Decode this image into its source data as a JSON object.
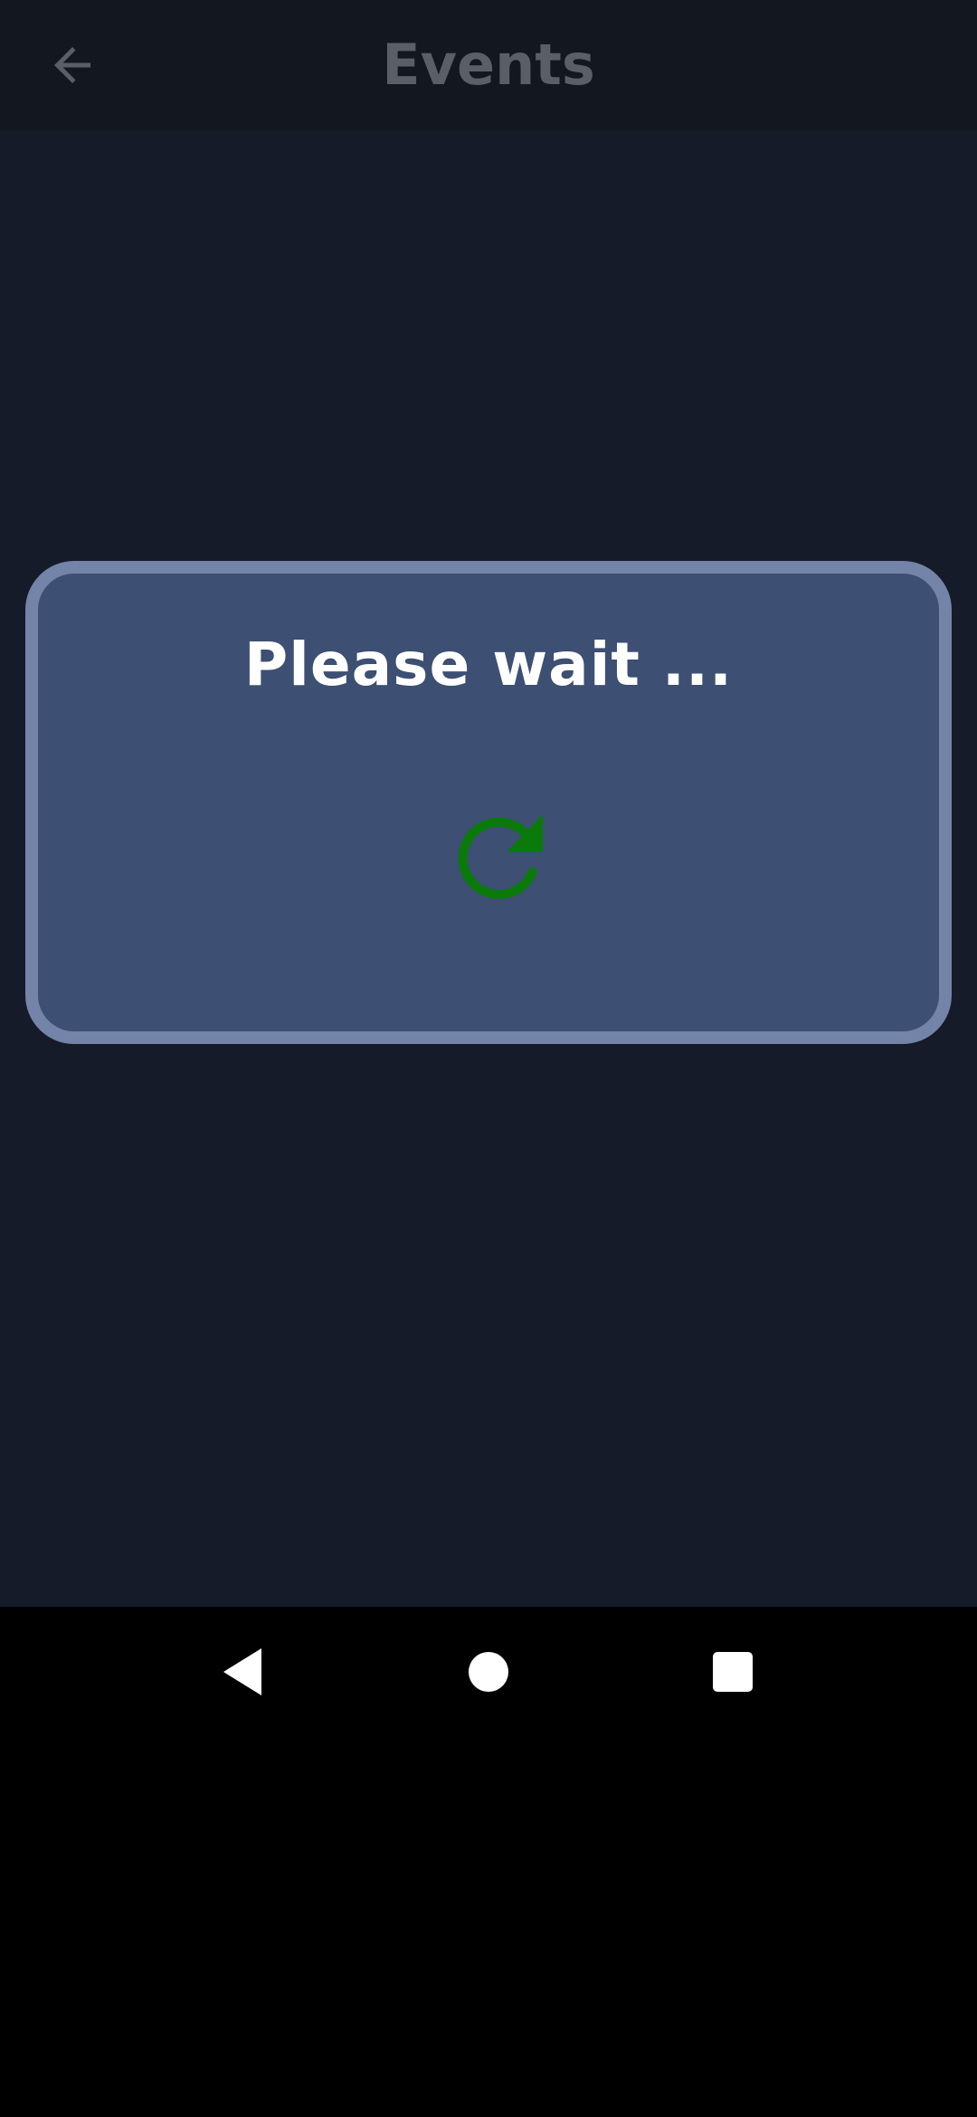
{
  "app_bar": {
    "title": "Events",
    "back_icon": "arrow-left-icon"
  },
  "dialog": {
    "title": "Please wait ...",
    "spinner_icon": "refresh-icon",
    "spinner_color": "#0a7a0a"
  },
  "nav_bar": {
    "back_icon": "triangle-back-icon",
    "home_icon": "circle-home-icon",
    "recents_icon": "square-recents-icon"
  },
  "colors": {
    "background": "#161b29",
    "app_bar": "#13171f",
    "dialog_fill": "#3d4f72",
    "dialog_border": "#7483a8",
    "title_text": "#5b5e66"
  }
}
